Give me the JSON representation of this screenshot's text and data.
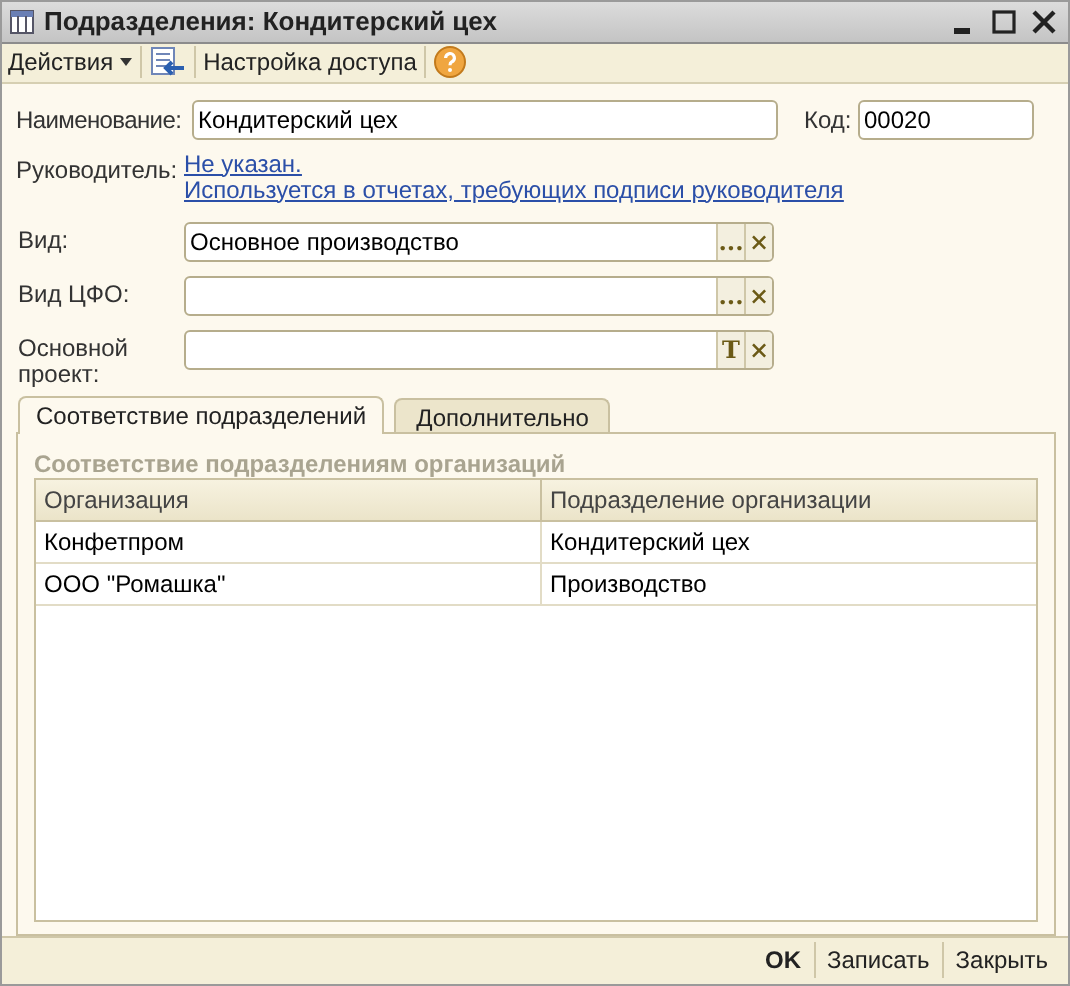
{
  "window": {
    "title": "Подразделения: Кондитерский цех"
  },
  "toolbar": {
    "actions": "Действия",
    "access": "Настройка доступа"
  },
  "name_field": {
    "label": "Наименование:",
    "value": "Кондитерский цех"
  },
  "code_field": {
    "label": "Код:",
    "value": "00020"
  },
  "manager": {
    "label": "Руководитель:",
    "link": "Не указан.",
    "hint": "Используется в отчетах, требующих подписи руководителя"
  },
  "fields": [
    {
      "label": "Вид:",
      "value": "Основное производство",
      "buttons": [
        "...",
        "×"
      ]
    },
    {
      "label": "Вид ЦФО:",
      "buttons": [
        "...",
        "×"
      ]
    },
    {
      "label": "Основной проект:",
      "buttons": [
        "T",
        "×"
      ]
    }
  ],
  "tabs": [
    {
      "label": "Соответствие подразделений",
      "selected": true
    },
    {
      "label": "Дополнительно",
      "selected": false
    }
  ],
  "group_title": "Соответствие подразделениям организаций",
  "table": {
    "columns": [
      "Организация",
      "Подразделение организации"
    ],
    "rows": [
      [
        "Конфетпром",
        "Кондитерский цех"
      ],
      [
        "ООО \"Ромашка\"",
        "Производство"
      ]
    ]
  },
  "buttons": [
    {
      "label": "OK",
      "kind": "default"
    },
    {
      "label": "Записать",
      "kind": "normal"
    },
    {
      "label": "Закрыть",
      "kind": "normal"
    }
  ]
}
